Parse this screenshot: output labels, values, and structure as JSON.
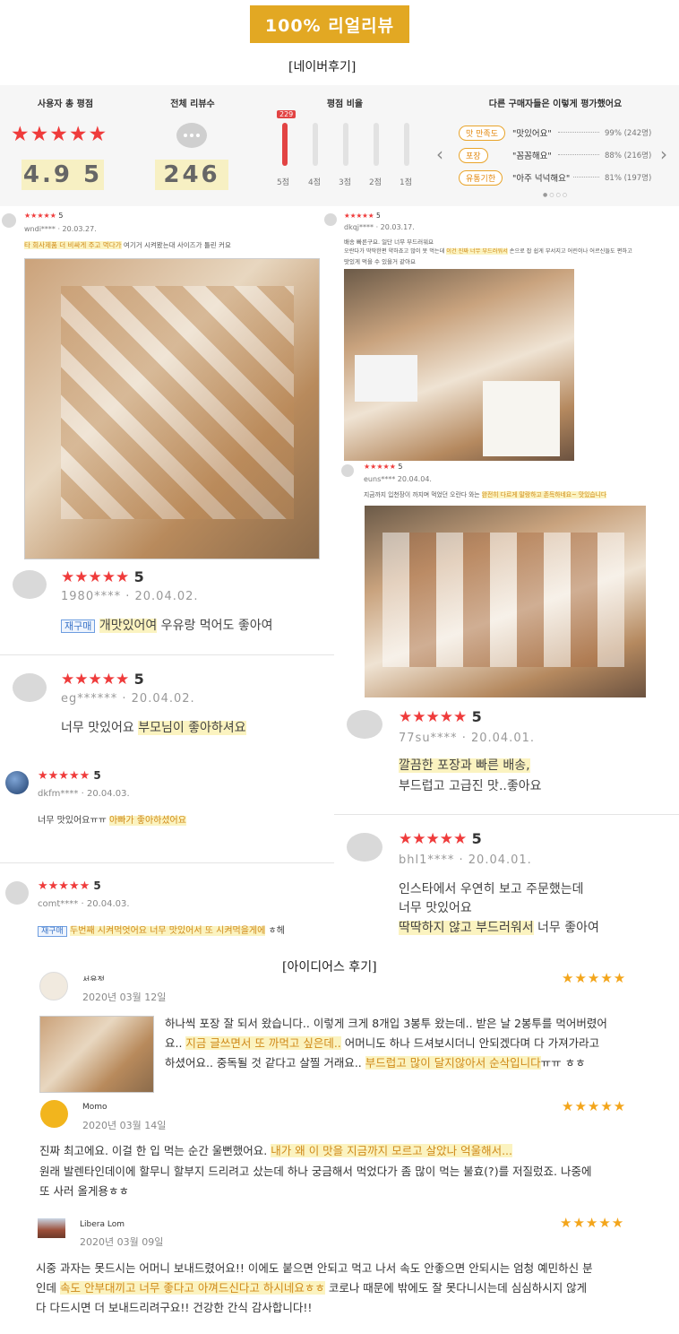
{
  "banner": "100% 리얼리뷰",
  "naver_title": "[네이버후기]",
  "idea_title": "[아이디어스 후기]",
  "summary": {
    "h1": "사용자 총 평점",
    "h2": "전체 리뷰수",
    "h3": "평점 비율",
    "h4": "다른 구매자들은 이렇게 평가했어요",
    "score": "4.9 5",
    "count": "246",
    "top_count": "229",
    "bars": [
      "5점",
      "4점",
      "3점",
      "2점",
      "1점"
    ],
    "ratings": [
      {
        "tag": "맛 만족도",
        "quote": "\"맛있어요\"",
        "pct": "99% (242명)"
      },
      {
        "tag": "포장",
        "quote": "\"꼼꼼해요\"",
        "pct": "88% (216명)"
      },
      {
        "tag": "유통기한",
        "quote": "\"아주 넉넉해요\"",
        "pct": "81% (197명)"
      }
    ],
    "prev": "‹",
    "next": "›"
  },
  "reviews": {
    "r1": {
      "stars": "★★★★★",
      "score": "5",
      "user": "wndi****",
      "date": "· 20.03.27.",
      "pre": "",
      "hl": "타 회사제품 더 비싸게 주고 먹다가",
      "post": " 여기거 시켜봤는대 사이즈가 틀린 커요"
    },
    "r2": {
      "stars": "★★★★★",
      "score": "5",
      "user": "dkqj****",
      "date": "· 20.03.17.",
      "l1": "배송 빠른구요. 일단 너무 부드러워요",
      "l2a": "오란다가 딱딱한편 약하죠고 많이 못 먹는데 ",
      "l2hl": "이건 진짜 너무 부드러워서",
      "l2b": " 손으로 잡 쉽게 부서지고 어린이나 어르신들도 편하고",
      "l3": "맛있게 먹을 수 있을거 같아요"
    },
    "r3": {
      "stars": "★★★★★",
      "score": "5",
      "user": "euns****",
      "date": "20.04.04.",
      "pre": "지금까지 입천장이 까지며 먹었던 오란다 와는 ",
      "hl": "완전히 다르게 말랑하고 존득하네요~ 맛있습니다"
    },
    "r4": {
      "stars": "★★★★★",
      "score": "5",
      "user": "1980****",
      "date": "· 20.04.02.",
      "badge": "재구매",
      "hl": "개맛있어여",
      "post": " 우유랑 먹어도 좋아여"
    },
    "r5": {
      "stars": "★★★★★",
      "score": "5",
      "user": "eg******",
      "date": "· 20.04.02.",
      "pre": "너무 맛있어요 ",
      "hl": "부모님이 좋아하셔요"
    },
    "r6": {
      "stars": "★★★★★",
      "score": "5",
      "user": "dkfm****",
      "date": "· 20.04.03.",
      "pre": "너무 맛있어요ㅠㅠ ",
      "hl": "아빠가 좋아하셨어요"
    },
    "r7": {
      "stars": "★★★★★",
      "score": "5",
      "user": "comt****",
      "date": "· 20.04.03.",
      "badge": "재구매",
      "hl": "두번째 시켜먹엇어요 너무 맛있어서 또 시켜먹을게에",
      "post": " ㅎ헤"
    },
    "r8": {
      "stars": "★★★★★",
      "score": "5",
      "user": "77su****",
      "date": "· 20.04.01.",
      "hl": "깔끔한 포장과 빠른 배송,",
      "l2": "부드럽고 고급진 맛..좋아요"
    },
    "r9": {
      "stars": "★★★★★",
      "score": "5",
      "user": "bhl1****",
      "date": "· 20.04.01.",
      "l1": "인스타에서 우연히 보고 주문했는데",
      "l2": "너무 맛있어요",
      "hl": "딱딱하지 않고 부드러워서",
      "post": " 너무 좋아여"
    }
  },
  "idea": {
    "i1": {
      "name": "서윤정",
      "date": "2020년 03월 12일",
      "stars": "★★★★★",
      "l1": "하나씩 포장 잘 되서 왔습니다.. 이렇게 크게 8개입 3봉투 왔는데.. 받은 날 2봉투를 먹어버렸어",
      "l2a": "요.. ",
      "l2hl": "지금 글쓰면서 또 까먹고 싶은데..",
      "l2b": " 어머니도 하나 드셔보시더니 안되겠다며 다 가져가라고",
      "l3a": "하셨어요.. 중독될 것 같다고 살찔 거래요.. ",
      "l3hl": "부드럽고 많이 달지않아서 순삭입니다",
      "l3b": "ㅠㅠ ㅎㅎ"
    },
    "i2": {
      "name": "Momo",
      "date": "2020년 03월 14일",
      "stars": "★★★★★",
      "l1a": "진짜 최고에요. 이걸 한 입 먹는 순간 울뻔했어요. ",
      "l1hl": "내가 왜 이 맛을 지금까지 모르고 살았나 억울해서...",
      "l2": "원래 발렌타인데이에 할무니 할부지 드리려고 샀는데 하나 궁금해서 먹었다가 좀 많이 먹는 불효(?)를 저질렀죠. 나중에",
      "l3": "또 사러 올게용ㅎㅎ"
    },
    "i3": {
      "name": "Libera Lom",
      "date": "2020년 03월 09일",
      "stars": "★★★★★",
      "l1": "시중 과자는 못드시는 어머니 보내드렸어요!! 이에도 붙으면 안되고 먹고 나서 속도 안좋으면 안되시는 엄청 예민하신 분",
      "l2a": "인데 ",
      "l2hl": "속도 안부대끼고 너무 좋다고 아껴드신다고 하시네요ㅎㅎ",
      "l2b": " 코로나 때문에 밖에도 잘 못다니시는데 심심하시지 않게",
      "l3": "다 다드시면 더 보내드리려구요!! 건강한 간식 감사합니다!!"
    }
  }
}
